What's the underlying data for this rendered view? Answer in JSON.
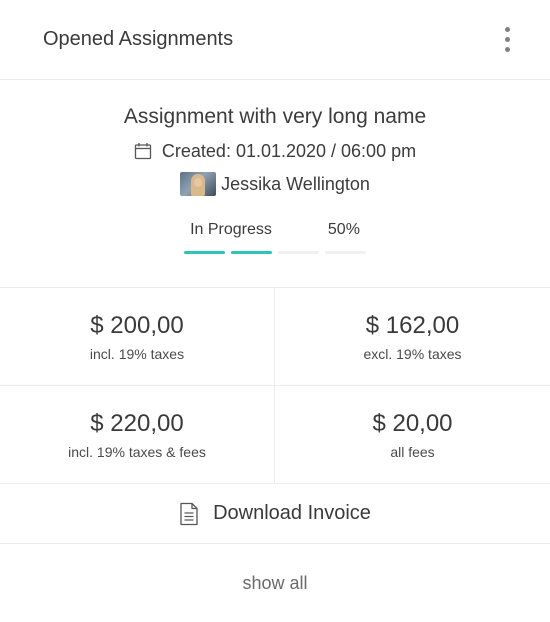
{
  "header": {
    "title": "Opened Assignments",
    "menu_icon": "more-vertical-icon"
  },
  "assignment": {
    "name": "Assignment with very long name",
    "created": "Created: 01.01.2020 / 06:00 pm",
    "user": "Jessika Wellington",
    "status_label": "In Progress",
    "progress_label": "50%",
    "progress_fraction": 0.5,
    "progress_segments": 4,
    "accent_color": "#2ec4b6"
  },
  "amounts": [
    {
      "value": "$ 200,00",
      "label": "incl. 19% taxes"
    },
    {
      "value": "$ 162,00",
      "label": "excl. 19% taxes"
    },
    {
      "value": "$ 220,00",
      "label": "incl. 19% taxes & fees"
    },
    {
      "value": "$ 20,00",
      "label": "all fees"
    }
  ],
  "download": {
    "label": "Download Invoice",
    "icon": "document-icon"
  },
  "footer": {
    "show_all": "show all"
  }
}
